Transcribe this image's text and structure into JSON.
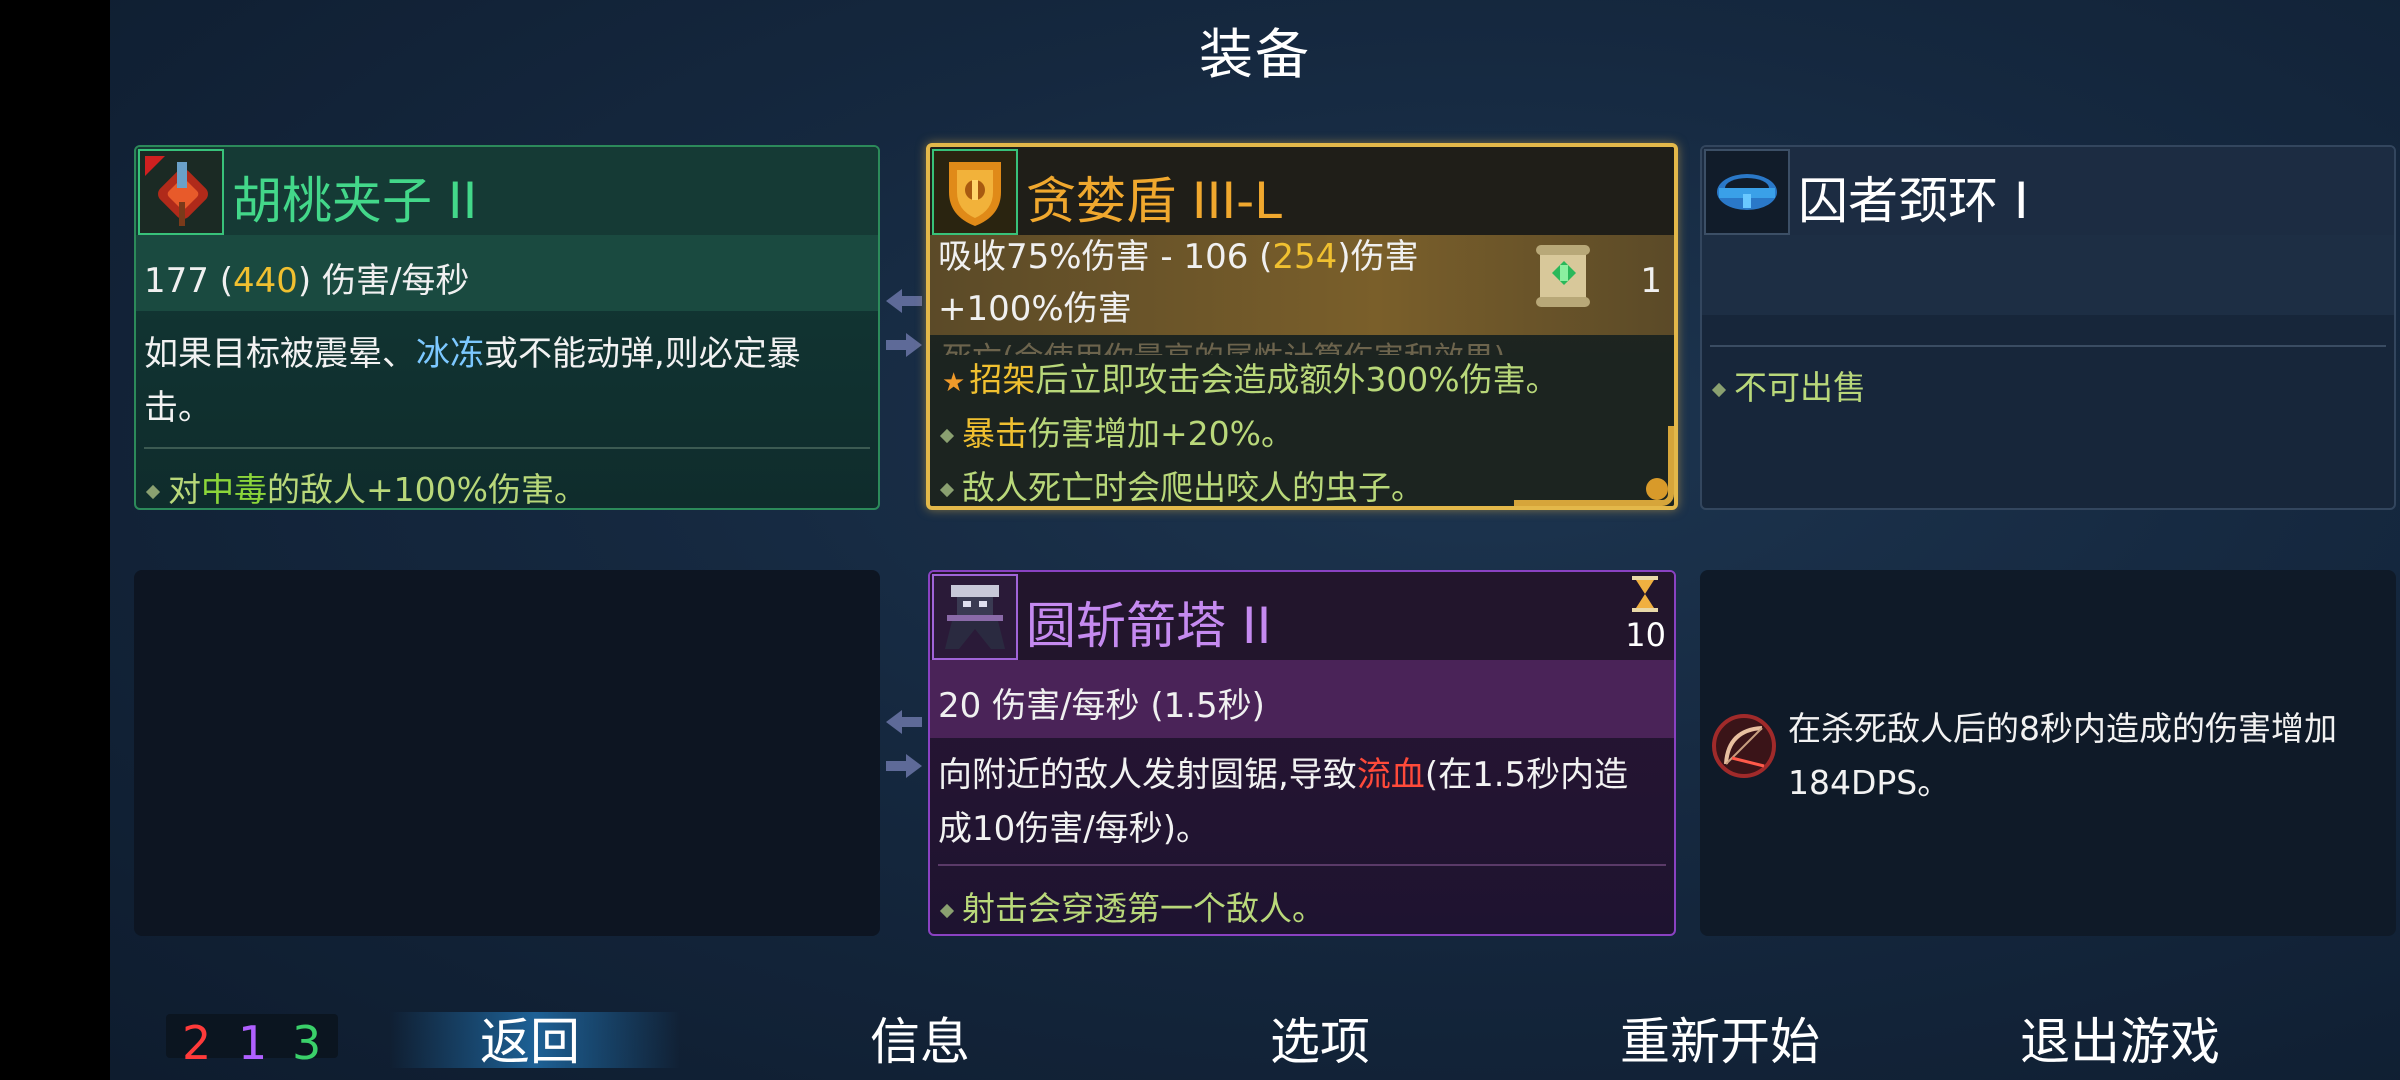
{
  "screen_title": "装备",
  "slots": {
    "melee": {
      "name": "胡桃夹子 II",
      "stat_base": "177 (",
      "stat_highlight": "440",
      "stat_tail": ") 伤害/每秒",
      "desc_a": "如果目标被震晕、",
      "desc_keyword": "冰冻",
      "desc_b": "或不能动弹,则必定暴击。",
      "bullet_a": "对",
      "bullet_keyword": "中毒",
      "bullet_b": "的敌人+100%伤害。",
      "icon": "nutcracker-weapon-icon"
    },
    "shield": {
      "name": "贪婪盾 III-L",
      "stat_line1_a": "吸收75%伤害 - 106 (",
      "stat_line1_highlight": "254",
      "stat_line1_b": ")伤害",
      "stat_line2": "+100%伤害",
      "scroll_count": "1",
      "ghost_line": "死亡(会使用你最高的属性计算伤害和效果)",
      "bullet1_keyword": "招架",
      "bullet1_rest": "后立即攻击会造成额外300%伤害。",
      "bullet2_keyword": "暴击",
      "bullet2_rest": "伤害增加+20%。",
      "bullet3": "敌人死亡时会爬出咬人的虫子。",
      "icon": "shield-icon"
    },
    "amulet": {
      "name": "囚者颈环 I",
      "bullet": "不可出售",
      "icon": "collar-amulet-icon"
    },
    "skill": {
      "name": "圆斩箭塔 II",
      "cooldown": "10",
      "stat": "20 伤害/每秒 (1.5秒)",
      "desc_a": "向附近的敌人发射圆锯,导致",
      "desc_keyword": "流血",
      "desc_b": "(在1.5秒内造成10伤害/每秒)。",
      "bullet": "射击会穿透第一个敌人。",
      "icon": "saw-turret-icon"
    },
    "mutation": {
      "text": "在杀死敌人后的8秒内造成的伤害增加184DPS。",
      "icon": "bow-mutation-icon"
    }
  },
  "scrolls": {
    "red": "2",
    "purple": "1",
    "green": "3"
  },
  "menu": {
    "back": "返回",
    "info": "信息",
    "options": "选项",
    "restart": "重新开始",
    "quit": "退出游戏"
  },
  "colors": {
    "gold": "#f0c030",
    "green": "#43d88a",
    "purple": "#c58af0",
    "freeze_blue": "#7cc8ff",
    "bleed_red": "#ff4a3a",
    "poison_green": "#8cd63a"
  }
}
